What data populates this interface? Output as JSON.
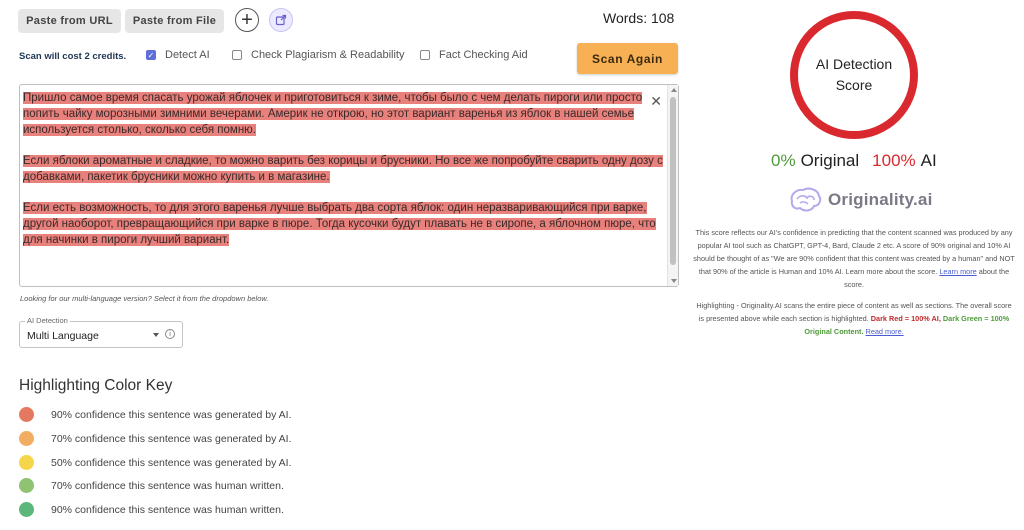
{
  "toolbar": {
    "paste_url": "Paste from URL",
    "paste_file": "Paste from File",
    "add_icon": "plus-icon",
    "export_icon": "export-icon",
    "words_label": "Words: 108"
  },
  "options": {
    "credits": "Scan will cost 2 credits.",
    "detect_ai": {
      "label": "Detect AI",
      "checked": true
    },
    "plagiarism": {
      "label": "Check Plagiarism & Readability",
      "checked": false
    },
    "fact_check": {
      "label": "Fact Checking Aid",
      "checked": false
    },
    "scan_again": "Scan Again"
  },
  "editor": {
    "paragraphs": [
      "Пришло самое время спасать урожай яблочек и приготовиться к зиме, чтобы было с чем делать пироги или просто попить чайку морозными зимними вечерами. Америк не открою, но этот вариант варенья из яблок в нашей семье используется столько, сколько себя помню.",
      "Если яблоки ароматные и сладкие, то можно варить без корицы и брусники. Но все же попробуйте сварить одну дозу с добавками, пакетик брусники можно купить и в магазине.",
      "Если есть возможность, то для этого варенья лучше выбрать два сорта яблок: один неразваривающийся при варке, другой наоборот, превращающийся при варке в пюре. Тогда кусочки будут плавать не в сиропе, а яблочном пюре, что для начинки в пироги лучший вариант."
    ],
    "close_icon": "close-icon",
    "highlight_color": "#e8807b"
  },
  "language": {
    "hint": "Looking for our multi-language version? Select it from the dropdown below.",
    "legend": "AI Detection",
    "value": "Multi Language",
    "info_glyph": "i"
  },
  "color_key": {
    "title": "Highlighting Color Key",
    "items": [
      {
        "color": "#e4795f",
        "label": "90% confidence this sentence was generated by AI."
      },
      {
        "color": "#f2ad62",
        "label": "70% confidence this sentence was generated by AI."
      },
      {
        "color": "#f5d54a",
        "label": "50% confidence this sentence was generated by AI."
      },
      {
        "color": "#8fc271",
        "label": "70% confidence this sentence was human written."
      },
      {
        "color": "#5cb87a",
        "label": "90% confidence this sentence was human written."
      }
    ]
  },
  "score": {
    "line1": "AI Detection",
    "line2": "Score",
    "original_pct": "0%",
    "original_label": "Original",
    "ai_pct": "100%",
    "ai_label": "AI",
    "ring_color": "#d9292e"
  },
  "brand": {
    "name": "Originality.ai",
    "logo_icon": "brain-icon"
  },
  "description": {
    "p1_text": "This score reflects our AI's confidence in predicting that the content scanned was produced by any popular AI tool such as ChatGPT, GPT-4, Bard, Claude 2 etc. A score of 90% original and 10% AI should be thought of as \"We are 90% confident that this content was created by a human\" and NOT that 90% of the article is Human and 10% AI. Learn more about the score.",
    "p1_link": "Learn more",
    "p1_tail": "about the score.",
    "p2_text": "Highlighting - Originality.AI scans the entire piece of content as well as sections. The overall score is presented above while each section is highlighted.",
    "p2_red": "Dark Red = 100% AI,",
    "p2_green": "Dark Green = 100% Original Content.",
    "p2_link": "Read more."
  }
}
